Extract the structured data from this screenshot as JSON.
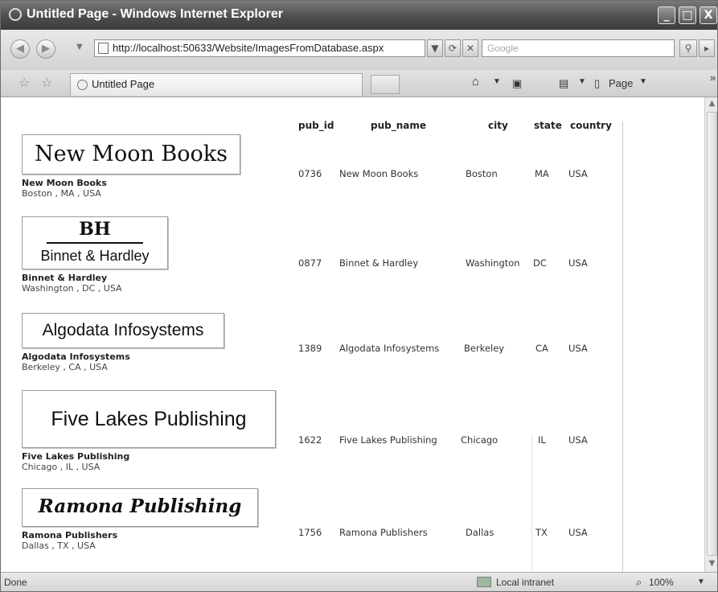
{
  "window": {
    "title": "Untitled Page - Windows Internet Explorer",
    "minimize": "_",
    "maximize": "□",
    "close": "X"
  },
  "address_bar": {
    "url": "http://localhost:50633/Website/ImagesFromDatabase.aspx",
    "search_placeholder": "Google"
  },
  "tab": {
    "label": "Untitled Page"
  },
  "command_bar": {
    "page_label": "Page"
  },
  "grid": {
    "headers": [
      "pub_id",
      "pub_name",
      "city",
      "state",
      "country"
    ],
    "rows": [
      {
        "pub_id": "0736",
        "pub_name": "New Moon Books",
        "city": "Boston",
        "state": "MA",
        "country": "USA"
      },
      {
        "pub_id": "0877",
        "pub_name": "Binnet & Hardley",
        "city": "Washington",
        "state": "DC",
        "country": "USA"
      },
      {
        "pub_id": "1389",
        "pub_name": "Algodata Infosystems",
        "city": "Berkeley",
        "state": "CA",
        "country": "USA"
      },
      {
        "pub_id": "1622",
        "pub_name": "Five Lakes Publishing",
        "city": "Chicago",
        "state": "IL",
        "country": "USA"
      },
      {
        "pub_id": "1756",
        "pub_name": "Ramona Publishers",
        "city": "Dallas",
        "state": "TX",
        "country": "USA"
      }
    ]
  },
  "publishers": [
    {
      "logo_text": "New Moon Books",
      "name": "New Moon Books",
      "location": "Boston , MA , USA"
    },
    {
      "logo_mark": "BH",
      "logo_text": "Binnet & Hardley",
      "name": "Binnet & Hardley",
      "location": "Washington , DC , USA"
    },
    {
      "logo_text": "Algodata Infosystems",
      "name": "Algodata Infosystems",
      "location": "Berkeley , CA , USA"
    },
    {
      "logo_text": "Five Lakes Publishing",
      "name": "Five Lakes Publishing",
      "location": "Chicago , IL , USA"
    },
    {
      "logo_text": "Ramona Publishing",
      "name": "Ramona Publishers",
      "location": "Dallas , TX , USA"
    }
  ],
  "status_bar": {
    "status": "Done",
    "zone": "Local intranet",
    "zoom": "100%"
  }
}
